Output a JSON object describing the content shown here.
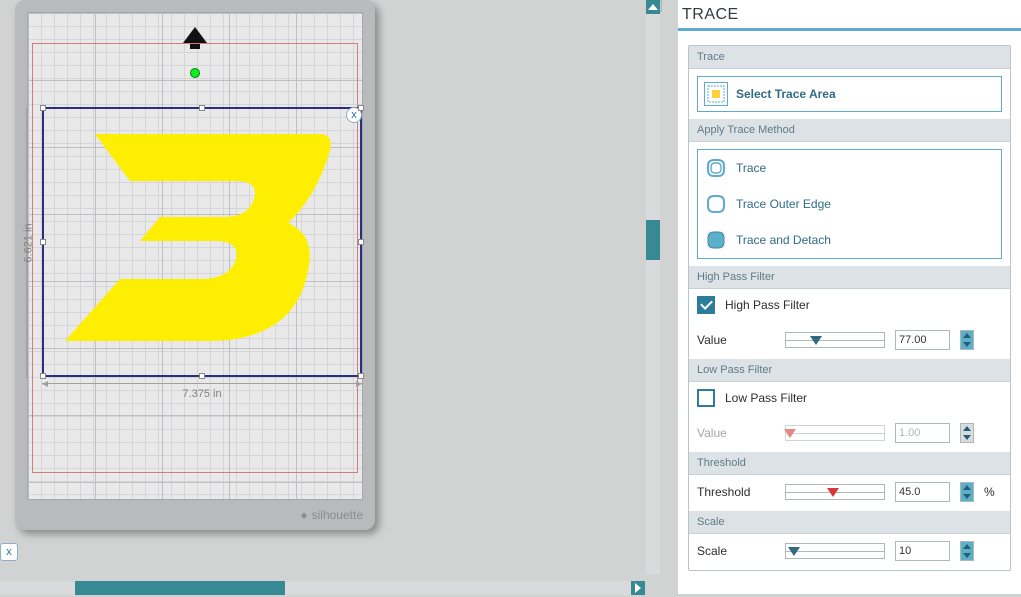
{
  "panel": {
    "title": "TRACE",
    "trace_section": "Trace",
    "select_trace_area": "Select Trace Area",
    "apply_method_section": "Apply Trace Method",
    "methods": {
      "trace": "Trace",
      "outer": "Trace Outer Edge",
      "detach": "Trace and Detach"
    },
    "hpf": {
      "section": "High Pass Filter",
      "checkbox": "High Pass Filter",
      "checked": true,
      "label": "Value",
      "value": "77.00",
      "slider_pct": 28
    },
    "lpf": {
      "section": "Low Pass Filter",
      "checkbox": "Low Pass Filter",
      "checked": false,
      "label": "Value",
      "value": "1.00",
      "slider_pct": 2
    },
    "threshold": {
      "section": "Threshold",
      "label": "Threshold",
      "value": "45.0",
      "suffix": "%",
      "slider_pct": 45
    },
    "scale": {
      "section": "Scale",
      "label": "Scale",
      "value": "10",
      "slider_pct": 6
    }
  },
  "canvas": {
    "width_label": "7.375 in",
    "height_label": "6.621 in",
    "brand": "silhouette",
    "close_x": "x",
    "colors": {
      "shape": "#feee02"
    }
  }
}
